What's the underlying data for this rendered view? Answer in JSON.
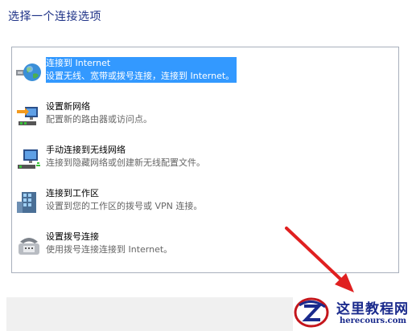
{
  "heading": "选择一个连接选项",
  "options": [
    {
      "title": "连接到 Internet",
      "desc": "设置无线、宽带或拨号连接，连接到 Internet。",
      "icon": "globe-network-icon",
      "selected": true
    },
    {
      "title": "设置新网络",
      "desc": "配置新的路由器或访问点。",
      "icon": "new-network-icon",
      "selected": false
    },
    {
      "title": "手动连接到无线网络",
      "desc": "连接到隐藏网络或创建新无线配置文件。",
      "icon": "wireless-network-icon",
      "selected": false
    },
    {
      "title": "连接到工作区",
      "desc": "设置到您的工作区的拨号或 VPN 连接。",
      "icon": "workplace-icon",
      "selected": false
    },
    {
      "title": "设置拨号连接",
      "desc": "使用拨号连接连接到 Internet。",
      "icon": "dialup-phone-icon",
      "selected": false
    }
  ],
  "watermark": {
    "title": "这里教程网",
    "url": "herecours.com"
  },
  "colors": {
    "selection": "#3399ff",
    "heading": "#1e3287",
    "annotation_arrow": "#e02020"
  }
}
